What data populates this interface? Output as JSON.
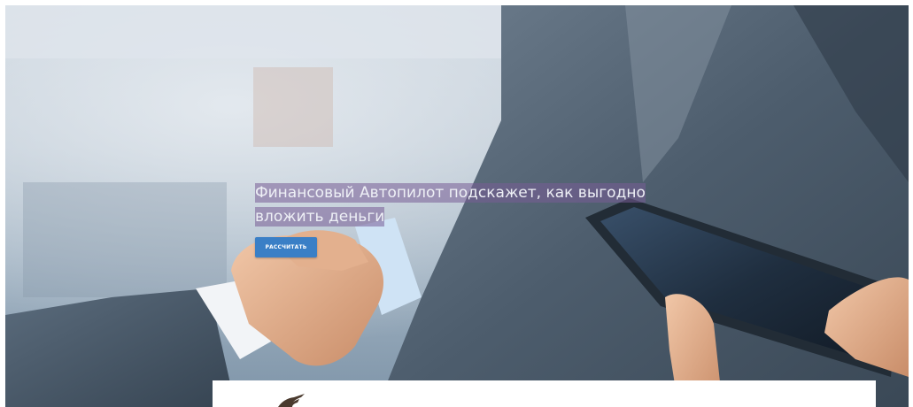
{
  "hero": {
    "headline": "Финансовый Автопилот подскажет, как выгодно вложить деньги",
    "cta_label": "РАССЧИТАТЬ"
  },
  "icons": {
    "panel_logo": "brand-logo-icon"
  },
  "colors": {
    "cta_background": "#3a7fc6",
    "headline_highlight": "#785c96",
    "page_background": "#ffffff"
  }
}
